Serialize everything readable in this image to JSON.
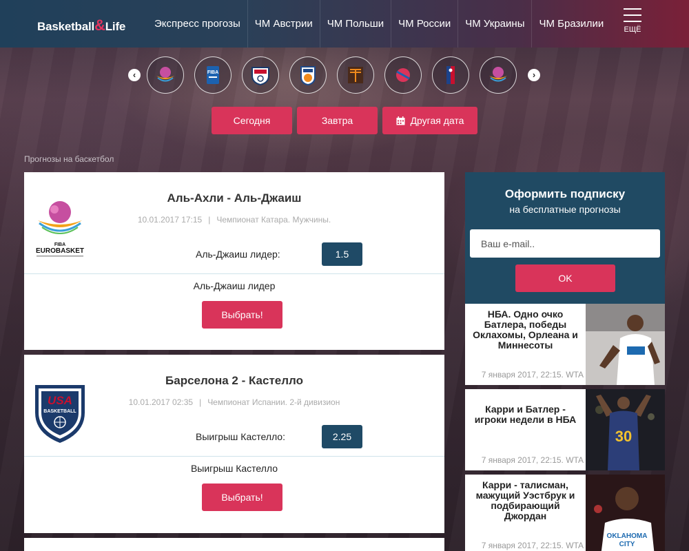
{
  "header": {
    "logo_left": "Basketball",
    "logo_amp": "&",
    "logo_right": "Life",
    "nav": [
      "Экспресс прогозы",
      "ЧМ Австрии",
      "ЧМ Польши",
      "ЧМ России",
      "ЧМ Украины",
      "ЧМ Бразилии"
    ],
    "more_label": "ЕЩЁ"
  },
  "carousel": {
    "prev": "‹",
    "next": "›",
    "leagues": [
      "eurobasket-icon",
      "fiba-europe-icon",
      "usa-basketball-icon",
      "vtb-league-icon",
      "euroleague-icon",
      "ncaa-icon",
      "nba-icon",
      "eurobasket-icon"
    ]
  },
  "date_buttons": {
    "today": "Сегодня",
    "tomorrow": "Завтра",
    "other": "Другая дата"
  },
  "breadcrumb": "Прогнозы на баскетбол",
  "matches": [
    {
      "logo": "eurobasket-logo",
      "title": "Аль-Ахли - Аль-Джаиш",
      "datetime": "10.01.2017 17:15",
      "separator": "|",
      "league": "Чемпионат Катара. Мужчины.",
      "bet_label": "Аль-Джаиш лидер:",
      "odds": "1.5",
      "pick": "Аль-Джаиш лидер",
      "button": "Выбрать!"
    },
    {
      "logo": "usa-basketball-logo",
      "title": "Барселона 2 - Кастелло",
      "datetime": "10.01.2017 02:35",
      "separator": "|",
      "league": "Чемпионат Испании. 2-й дивизион",
      "bet_label": "Выигрыш Кастелло:",
      "odds": "2.25",
      "pick": "Выигрыш Кастелло",
      "button": "Выбрать!"
    }
  ],
  "subscribe": {
    "title": "Оформить подписку",
    "subtitle": "на бесплатные прогнозы",
    "email_placeholder": "Ваш e-mail..",
    "button": "OK"
  },
  "news": [
    {
      "title": "НБА. Одно очко Батлера, победы Оклахомы, Орлеана и Миннесоты",
      "date": "7 января 2017, 22:15. WTA"
    },
    {
      "title": "Карри и Батлер - игроки недели в НБА",
      "date": "7 января 2017, 22:15. WTA"
    },
    {
      "title": "Карри - талисман, мажущий Уэстбрук и подбирающий Джордан",
      "date": "7 января 2017, 22:15. WTA"
    }
  ],
  "colors": {
    "accent": "#d9345a",
    "navy": "#1f4a66",
    "panel": "#204a63"
  }
}
